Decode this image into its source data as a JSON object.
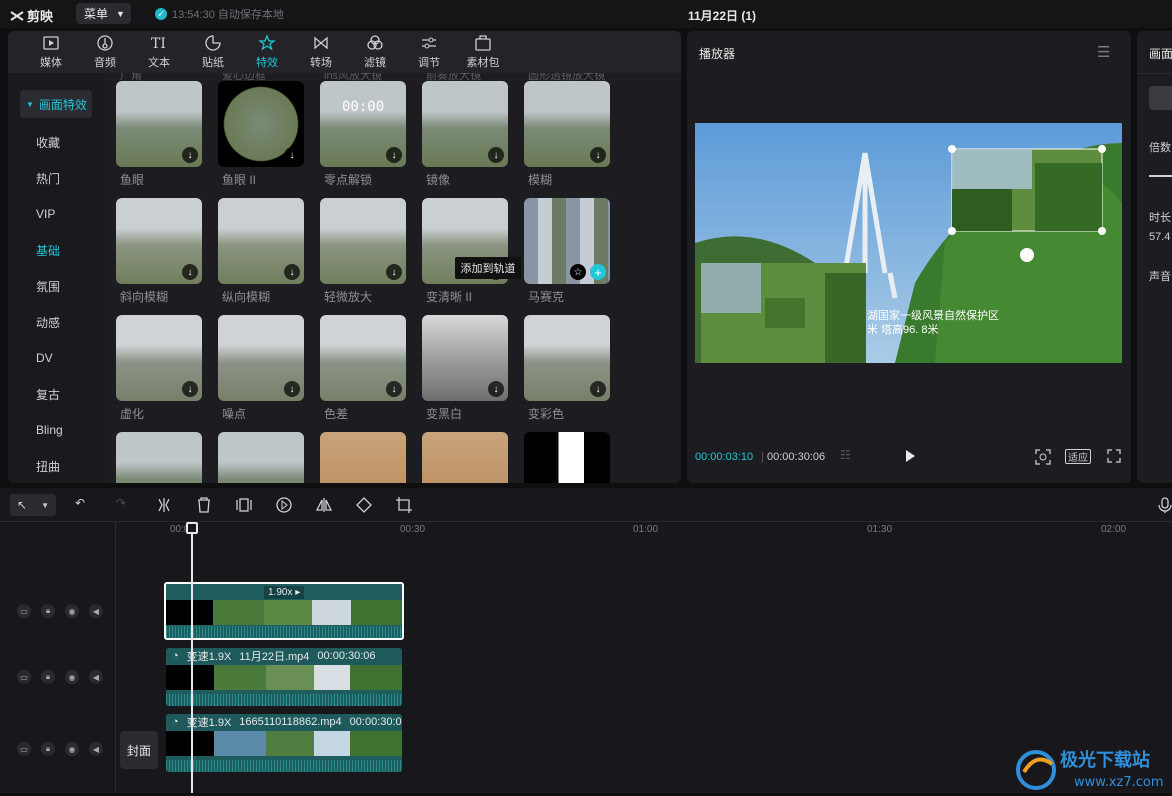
{
  "app": {
    "name": "剪映",
    "menu_label": "菜单",
    "autosave": "13:54:30 自动保存本地",
    "project_title": "11月22日 (1)"
  },
  "tabs": [
    {
      "label": "媒体",
      "icon": "media-icon"
    },
    {
      "label": "音频",
      "icon": "audio-icon"
    },
    {
      "label": "文本",
      "icon": "text-icon"
    },
    {
      "label": "贴纸",
      "icon": "sticker-icon"
    },
    {
      "label": "特效",
      "icon": "effects-icon",
      "active": true
    },
    {
      "label": "转场",
      "icon": "transition-icon"
    },
    {
      "label": "滤镜",
      "icon": "filter-icon"
    },
    {
      "label": "调节",
      "icon": "adjust-icon"
    },
    {
      "label": "素材包",
      "icon": "package-icon"
    }
  ],
  "sidebar": {
    "header": "画面特效",
    "items": [
      "收藏",
      "热门",
      "VIP",
      "基础",
      "氛围",
      "动感",
      "DV",
      "复古",
      "Bling",
      "扭曲"
    ],
    "active": "基础"
  },
  "partial_top_labels": [
    "广角",
    "爱心边框",
    "ins风放大镜",
    "前奏放大镜",
    "圆形透镜放大镜"
  ],
  "effects": [
    [
      "鱼眼",
      "鱼眼 II",
      "零点解锁",
      "镜像",
      "模糊"
    ],
    [
      "斜向模糊",
      "纵向模糊",
      "轻微放大",
      "变清晰 II",
      "马赛克"
    ],
    [
      "虚化",
      "噪点",
      "色差",
      "变黑白",
      "变彩色"
    ]
  ],
  "countdown_text": "00:00",
  "tooltip": "添加到轨道",
  "player": {
    "title": "播放器",
    "current_time": "00:00:03:10",
    "total_time": "00:00:30:06",
    "fit_label": "适应",
    "caption_line1": "湖国家一级风景自然保护区",
    "caption_line2": "米  塔高96. 8米"
  },
  "right_panel": {
    "title": "画面",
    "labels": [
      "倍数",
      "时长",
      "声音"
    ],
    "duration_partial": "57.4"
  },
  "timeline": {
    "ticks": [
      "00:00",
      "00:30",
      "01:00",
      "01:30",
      "02:00"
    ],
    "cover_label": "封面",
    "clip1": {
      "speed_label": "1.90x"
    },
    "clip2": {
      "speed": "变速1.9X",
      "name": "11月22日.mp4",
      "duration": "00:00:30:06"
    },
    "clip3": {
      "speed": "变速1.9X",
      "name": "1665110118862.mp4",
      "duration": "00:00:30:0"
    }
  },
  "colors": {
    "accent": "#22c7d8",
    "panel": "#1d1d21",
    "clip": "#1e5a5c"
  }
}
